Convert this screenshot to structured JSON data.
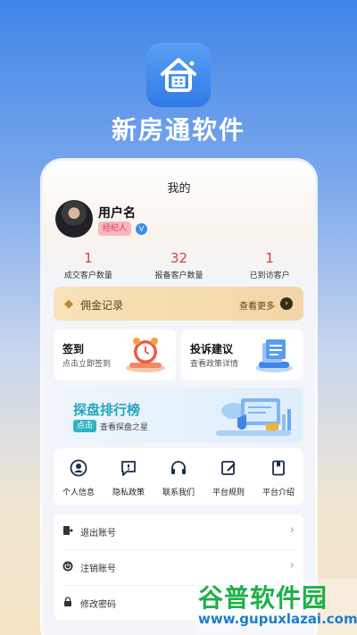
{
  "app": {
    "title": "新房通软件"
  },
  "header": {
    "title": "我的"
  },
  "profile": {
    "username": "用户名",
    "role": "经纪人",
    "verified_mark": "V"
  },
  "stats": [
    {
      "value": "1",
      "label": "成交客户数量"
    },
    {
      "value": "32",
      "label": "报备客户数量"
    },
    {
      "value": "1",
      "label": "已到访客户"
    }
  ],
  "commission": {
    "title": "佣金记录",
    "more": "查看更多",
    "arrow": "›"
  },
  "cards": {
    "checkin": {
      "title": "签到",
      "sub": "点击立即签到"
    },
    "complaint": {
      "title": "投诉建议",
      "sub": "查看政策详情"
    }
  },
  "ranking": {
    "title": "探盘排行榜",
    "tag": "点击",
    "sub": "查看探盘之星"
  },
  "menu": [
    {
      "label": "个人信息",
      "icon": "person-icon"
    },
    {
      "label": "隐私政策",
      "icon": "privacy-icon"
    },
    {
      "label": "联系我们",
      "icon": "headset-icon"
    },
    {
      "label": "平台规则",
      "icon": "rules-icon"
    },
    {
      "label": "平台介绍",
      "icon": "intro-icon"
    }
  ],
  "settings": [
    {
      "label": "退出账号",
      "icon": "logout-icon"
    },
    {
      "label": "注销账号",
      "icon": "power-icon"
    },
    {
      "label": "修改密码",
      "icon": "lock-icon"
    }
  ],
  "watermark": {
    "main": "谷普软件园",
    "url": "www.gupuxlazai.com"
  },
  "colors": {
    "accent": "#3f86e8",
    "stat": "#d64040",
    "rank": "#23a7b8",
    "badge": "#e23b50"
  }
}
